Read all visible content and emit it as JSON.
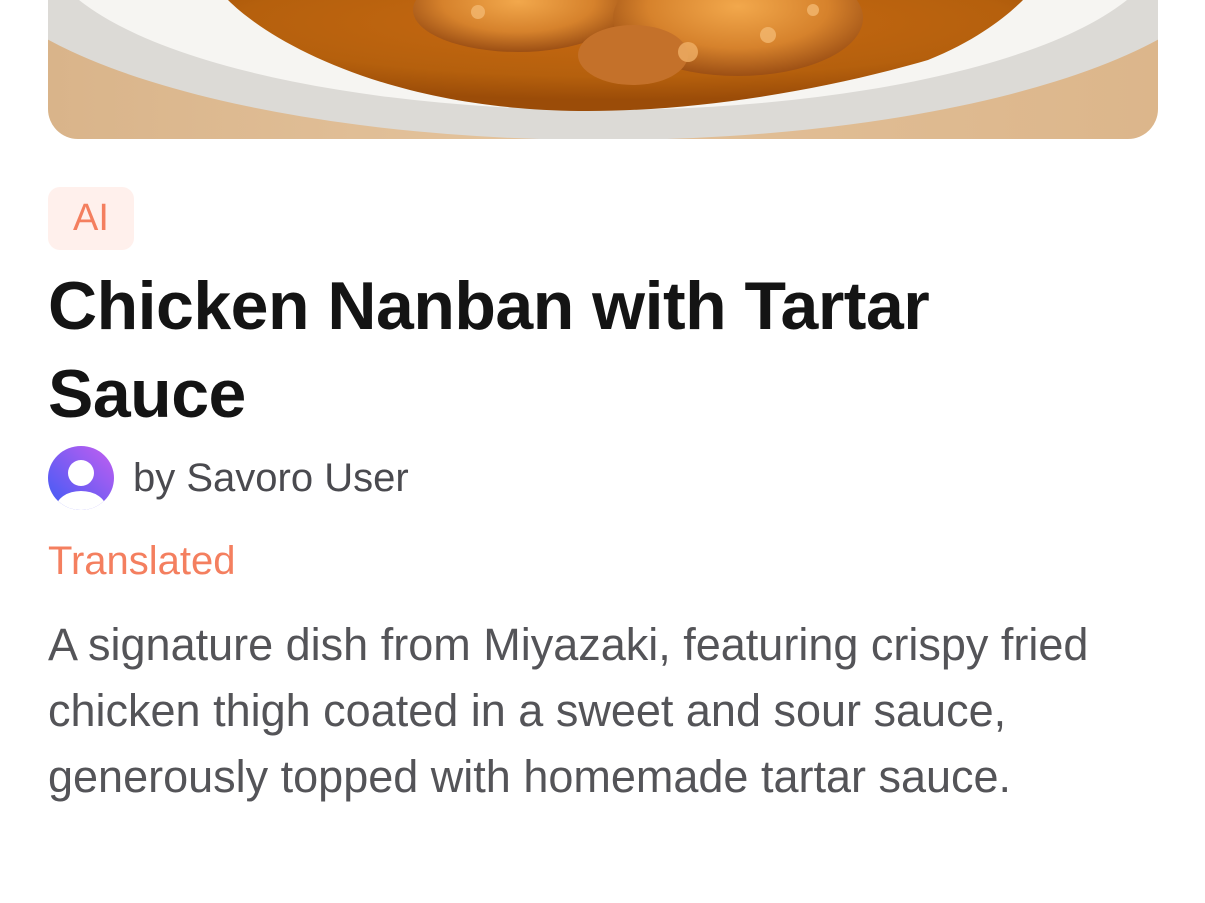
{
  "hero": {
    "image_name": "chicken-nanban-photo"
  },
  "badge": {
    "label": "AI"
  },
  "recipe": {
    "title": "Chicken Nanban with Tartar Sauce",
    "author": "by Savoro User",
    "translated_label": "Translated",
    "description": "A signature dish from Miyazaki, featuring crispy fried chicken thigh coated in a sweet and sour sauce, generously topped with homemade tartar sauce."
  },
  "colors": {
    "accent": "#f47f5f",
    "badge_bg": "#fff0ec",
    "title": "#141414",
    "body_text": "#545458"
  }
}
